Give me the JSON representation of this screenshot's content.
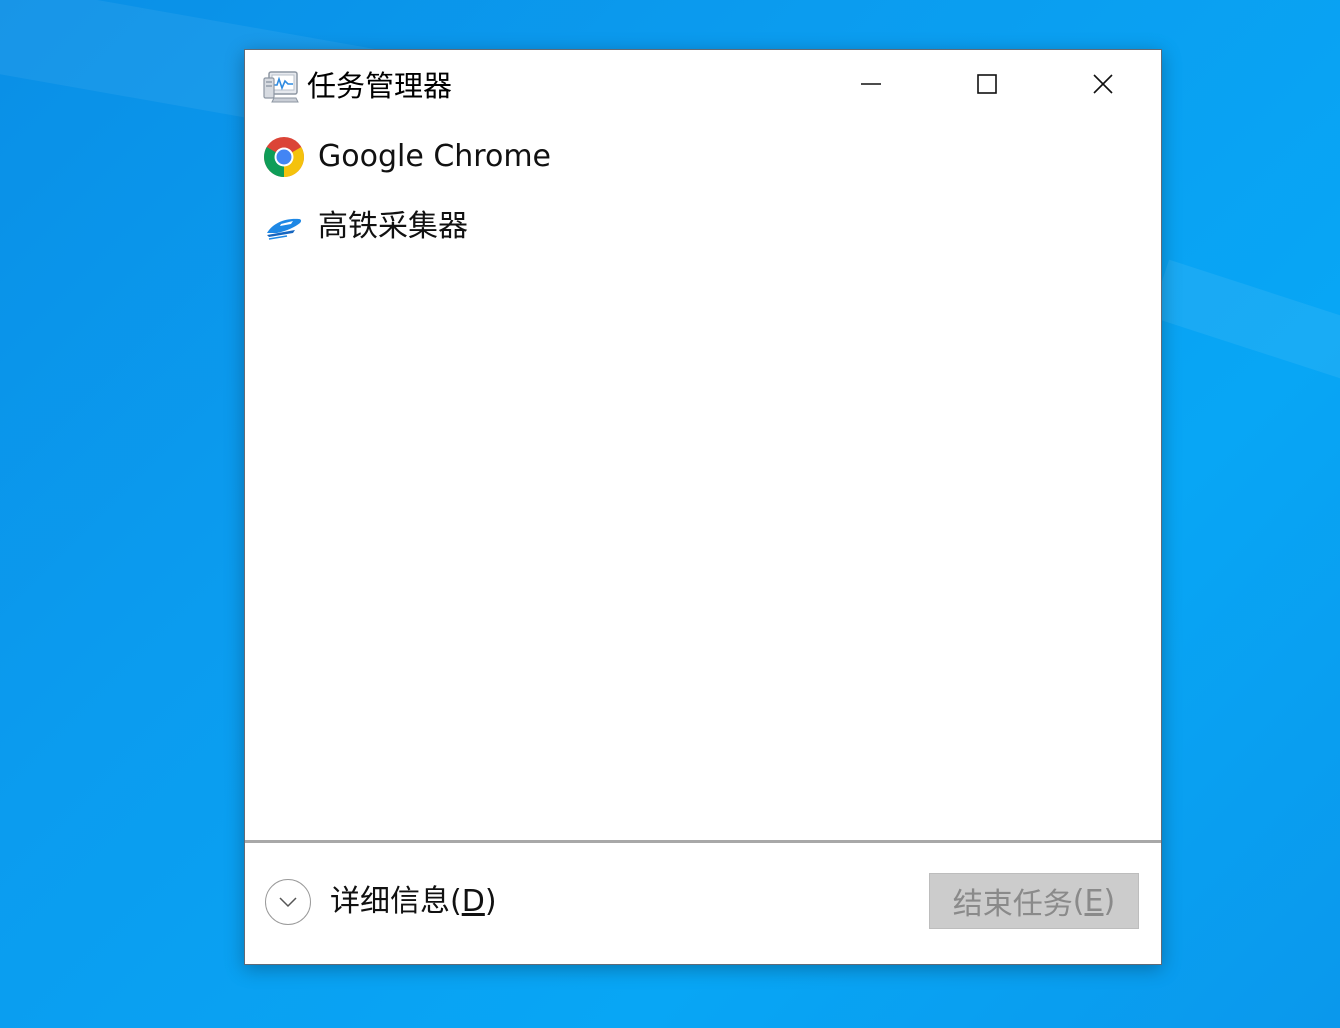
{
  "window": {
    "title": "任务管理器",
    "icon": "task-manager-icon"
  },
  "controls": {
    "minimize_icon": "minimize-icon",
    "maximize_icon": "maximize-icon",
    "close_icon": "close-icon"
  },
  "processes": [
    {
      "label": "Google Chrome",
      "icon": "chrome-icon"
    },
    {
      "label": "高铁采集器",
      "icon": "train-icon"
    }
  ],
  "footer": {
    "details_text": "详细信息",
    "details_paren_open": "(",
    "details_hotkey": "D",
    "details_paren_close": ")",
    "end_task_text": "结束任务",
    "end_task_paren_open": "(",
    "end_task_hotkey": "E",
    "end_task_paren_close": ")"
  },
  "colors": {
    "desktop_bg": "#0a9bef",
    "window_bg": "#ffffff",
    "disabled_button_bg": "#cccccc",
    "disabled_text": "#8a8a8a"
  }
}
